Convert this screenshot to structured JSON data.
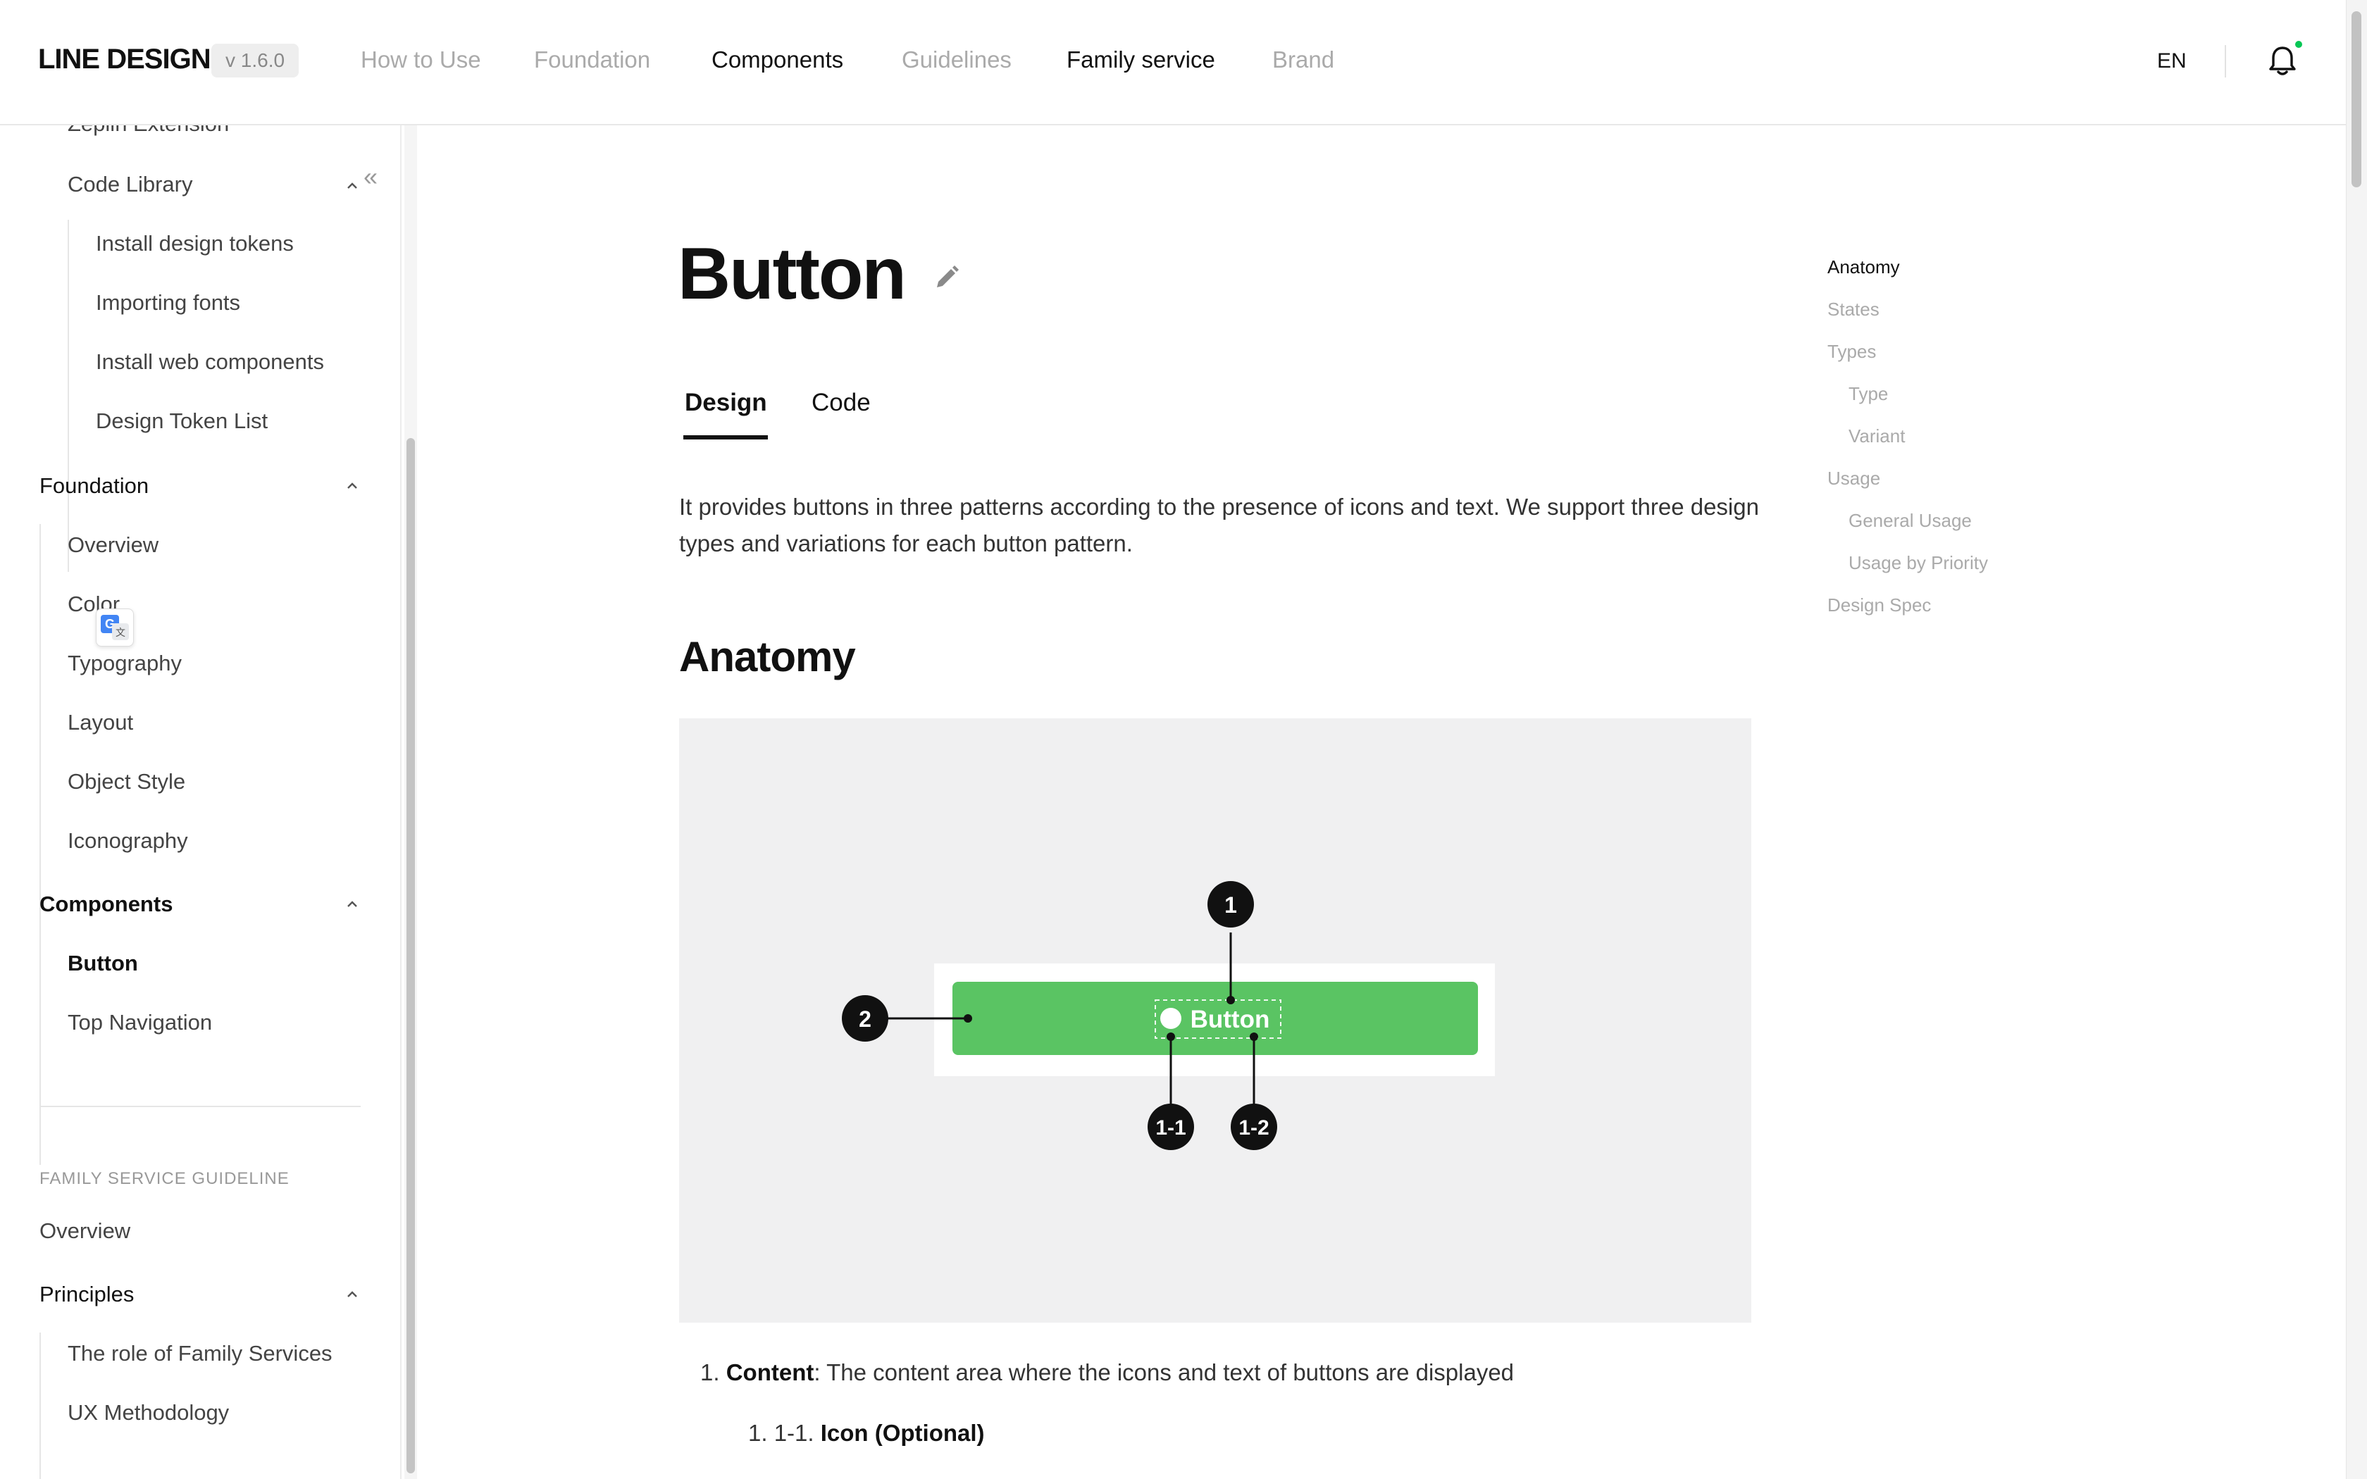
{
  "header": {
    "logo": "LINE DESIGN",
    "version": "v 1.6.0",
    "nav": [
      {
        "label": "How to Use",
        "active": false
      },
      {
        "label": "Foundation",
        "active": false
      },
      {
        "label": "Components",
        "active": true
      },
      {
        "label": "Guidelines",
        "active": false
      },
      {
        "label": "Family service",
        "active": true
      },
      {
        "label": "Brand",
        "active": false
      }
    ],
    "language": "EN",
    "icons": {
      "notification": "bell-icon"
    },
    "notification_dot_color": "#06c755"
  },
  "sidebar": {
    "items": [
      {
        "label": "Zeplin Extension"
      },
      {
        "label": "Code Library"
      },
      {
        "label": "Install design tokens"
      },
      {
        "label": "Importing fonts"
      },
      {
        "label": "Install web components"
      },
      {
        "label": "Design Token List"
      },
      {
        "label": "Foundation"
      },
      {
        "label": "Overview"
      },
      {
        "label": "Color"
      },
      {
        "label": "Typography"
      },
      {
        "label": "Layout"
      },
      {
        "label": "Object Style"
      },
      {
        "label": "Iconography"
      },
      {
        "label": "Components"
      },
      {
        "label": "Button",
        "active": true
      },
      {
        "label": "Top Navigation"
      },
      {
        "label": "Overview"
      },
      {
        "label": "Principles"
      },
      {
        "label": "The role of Family Services"
      },
      {
        "label": "UX Methodology"
      }
    ],
    "section_label": "FAMILY SERVICE GUIDELINE",
    "collapse_glyph": "«",
    "icons": {
      "collapse": "double-chevron-left-icon",
      "expand": "chevron-up-icon",
      "translate": "google-translate-icon"
    }
  },
  "main": {
    "title": "Button",
    "icons": {
      "edit": "pencil-icon"
    },
    "tabs": [
      {
        "label": "Design",
        "active": true
      },
      {
        "label": "Code",
        "active": false
      }
    ],
    "intro": "It provides buttons in three patterns according to the presence of icons and text. We support three design types and variations for each button pattern.",
    "section_title": "Anatomy",
    "anatomy": {
      "button_label": "Button",
      "markers": [
        "1",
        "2",
        "1-1",
        "1-2"
      ],
      "button_color": "#5ac463",
      "background_color": "#f0f0f1"
    },
    "list": [
      {
        "number": "1.",
        "term": "Content",
        "text": ": The content area where the icons and text of buttons are displayed"
      },
      {
        "number": "1. 1-1.",
        "term": "Icon (Optional)",
        "text": ""
      }
    ]
  },
  "toc": {
    "items": [
      {
        "label": "Anatomy",
        "active": true
      },
      {
        "label": "States"
      },
      {
        "label": "Types"
      },
      {
        "label": "Type"
      },
      {
        "label": "Variant"
      },
      {
        "label": "Usage"
      },
      {
        "label": "General Usage"
      },
      {
        "label": "Usage by Priority"
      },
      {
        "label": "Design Spec"
      }
    ]
  }
}
